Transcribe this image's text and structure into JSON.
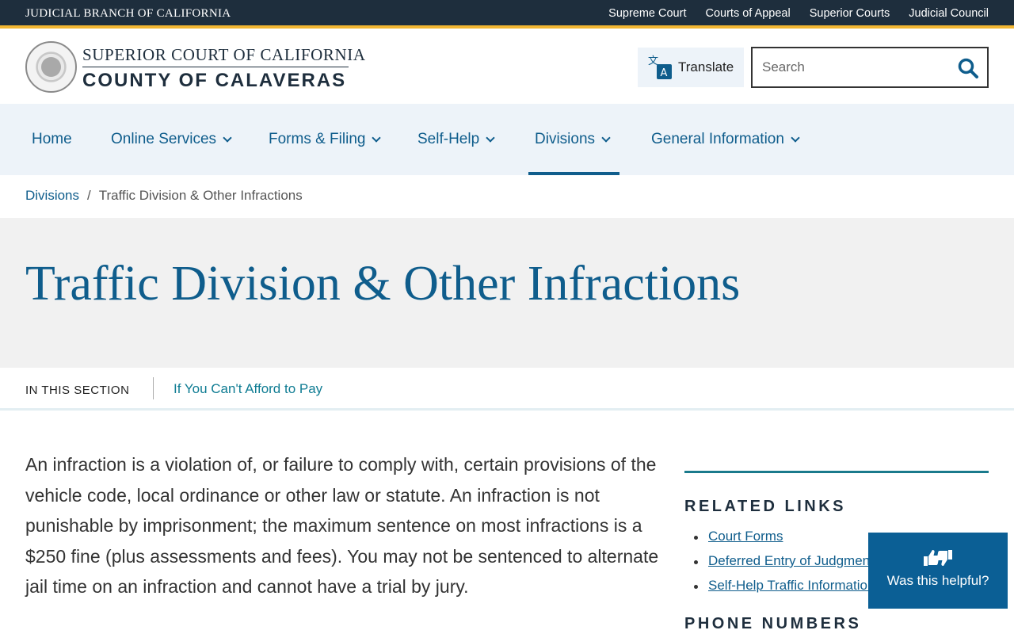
{
  "topbar": {
    "brand": "JUDICIAL BRANCH OF CALIFORNIA",
    "links": [
      "Supreme Court",
      "Courts of Appeal",
      "Superior Courts",
      "Judicial Council"
    ]
  },
  "header": {
    "line1": "SUPERIOR COURT OF CALIFORNIA",
    "line2": "COUNTY OF CALAVERAS",
    "translate_label": "Translate",
    "search_placeholder": "Search"
  },
  "nav": {
    "items": [
      "Home",
      "Online Services",
      "Forms & Filing",
      "Self-Help",
      "Divisions",
      "General Information"
    ],
    "active": "Divisions"
  },
  "breadcrumb": {
    "parent": "Divisions",
    "separator": "/",
    "current": "Traffic Division & Other Infractions"
  },
  "page": {
    "title": "Traffic Division & Other Infractions"
  },
  "section": {
    "label": "IN THIS SECTION",
    "link": "If You Can't Afford to Pay"
  },
  "content": {
    "paragraph": "An infraction is a violation of, or failure to comply with, certain provisions of the vehicle code, local ordinance or other law or statute. An infraction is not punishable by imprisonment; the maximum sentence on most infractions is a $250 fine (plus assessments and fees). You may not be sentenced to alternate jail time on an infraction and cannot have a trial by jury."
  },
  "aside": {
    "related_heading": "RELATED LINKS",
    "related_links": [
      "Court Forms",
      "Deferred Entry of Judgment",
      "Self-Help Traffic Information"
    ],
    "phone_heading": "PHONE NUMBERS"
  },
  "feedback": {
    "label": "Was this helpful?"
  },
  "colors": {
    "topbar": "#1e2e3d",
    "accent_gold": "#f2b632",
    "brand_blue": "#0f5d8c",
    "nav_bg": "#edf3f9",
    "feedback_bg": "#0b5f95"
  }
}
